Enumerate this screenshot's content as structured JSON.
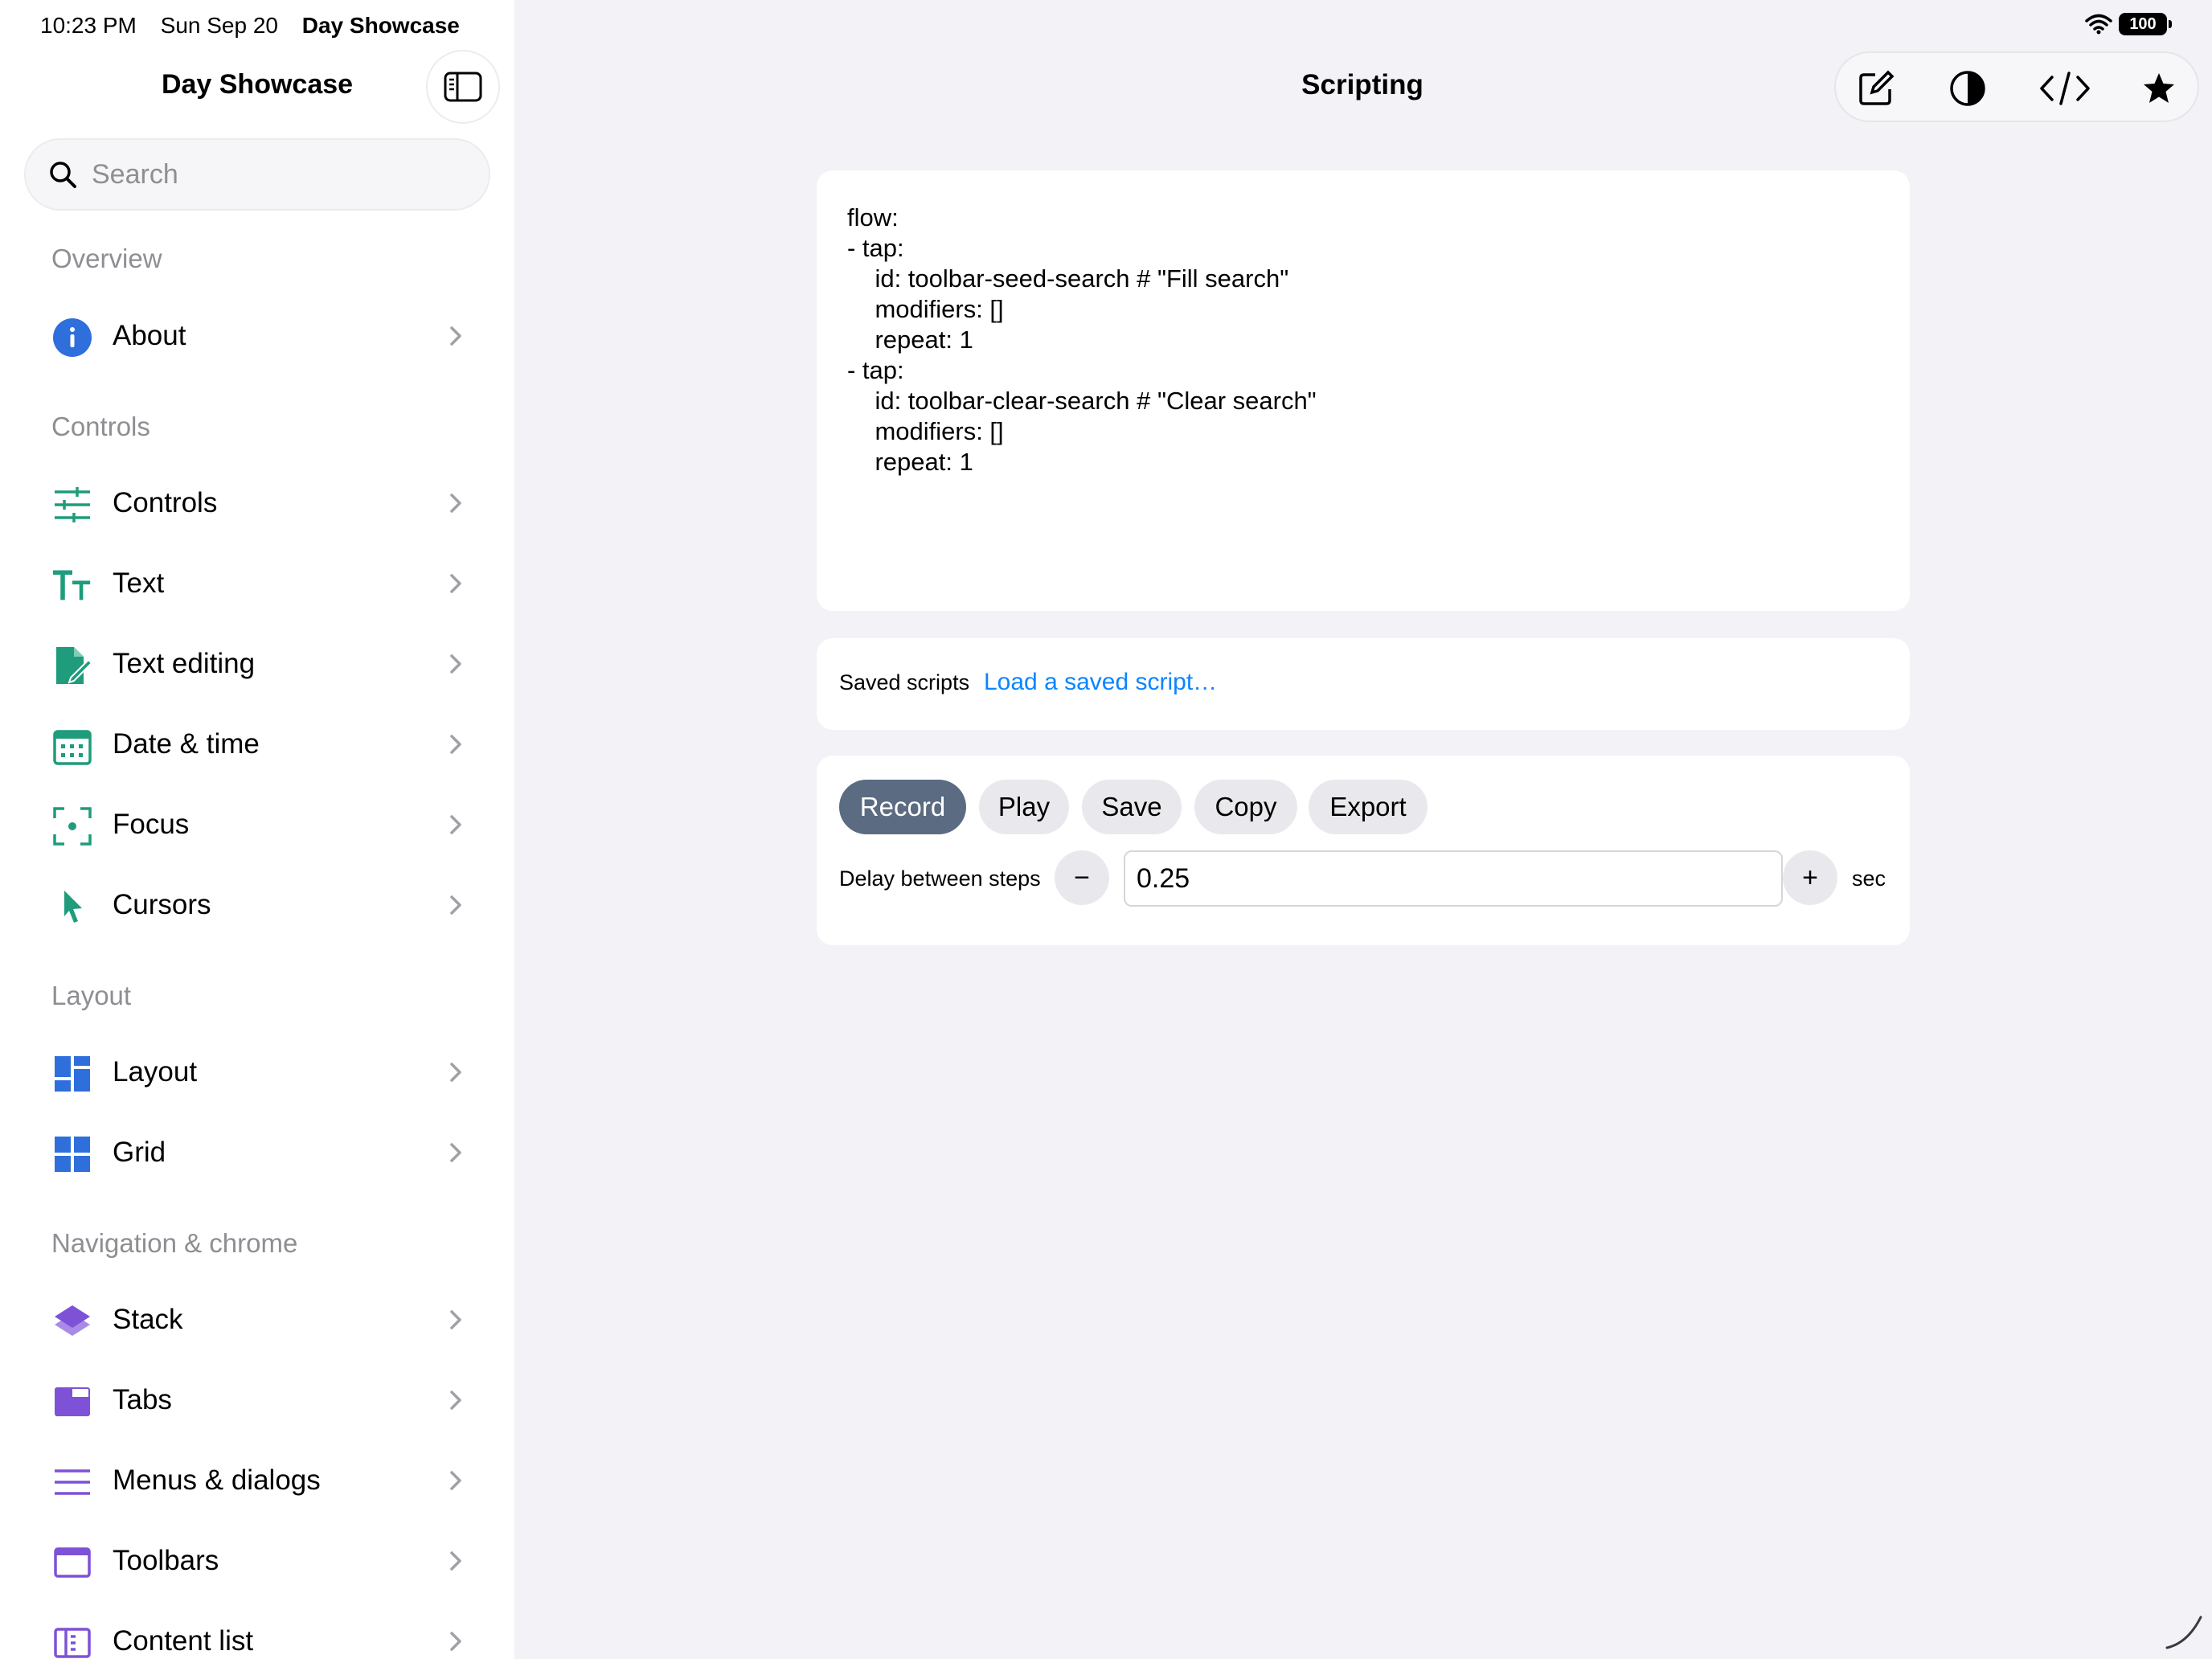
{
  "status_bar": {
    "time": "10:23 PM",
    "date": "Sun Sep 20",
    "app": "Day Showcase",
    "battery": "100"
  },
  "sidebar": {
    "title": "Day Showcase",
    "search_placeholder": "Search",
    "sections": [
      {
        "header": "Overview",
        "items": [
          {
            "label": "About",
            "icon": "info-circle-icon",
            "color": "#2f6fdc"
          }
        ]
      },
      {
        "header": "Controls",
        "items": [
          {
            "label": "Controls",
            "icon": "sliders-icon",
            "color": "#1e9c7c"
          },
          {
            "label": "Text",
            "icon": "text-size-icon",
            "color": "#1e9c7c"
          },
          {
            "label": "Text editing",
            "icon": "document-edit-icon",
            "color": "#1e9c7c"
          },
          {
            "label": "Date & time",
            "icon": "calendar-icon",
            "color": "#1e9c7c"
          },
          {
            "label": "Focus",
            "icon": "focus-viewfinder-icon",
            "color": "#1e9c7c"
          },
          {
            "label": "Cursors",
            "icon": "cursor-arrow-icon",
            "color": "#1e9c7c"
          }
        ]
      },
      {
        "header": "Layout",
        "items": [
          {
            "label": "Layout",
            "icon": "layout-grid-icon",
            "color": "#2f6fdc"
          },
          {
            "label": "Grid",
            "icon": "grid-icon",
            "color": "#2f6fdc"
          }
        ]
      },
      {
        "header": "Navigation & chrome",
        "items": [
          {
            "label": "Stack",
            "icon": "layers-stack-icon",
            "color": "#7d52d6"
          },
          {
            "label": "Tabs",
            "icon": "tabs-icon",
            "color": "#7d52d6"
          },
          {
            "label": "Menus & dialogs",
            "icon": "menu-lines-icon",
            "color": "#7d52d6"
          },
          {
            "label": "Toolbars",
            "icon": "toolbar-window-icon",
            "color": "#7d52d6"
          },
          {
            "label": "Content list",
            "icon": "content-list-icon",
            "color": "#7d52d6"
          }
        ]
      }
    ]
  },
  "main": {
    "title": "Scripting",
    "toolbar_icons": [
      "compose-icon",
      "contrast-icon",
      "code-icon",
      "star-icon"
    ],
    "script_text": "flow:\n- tap:\n    id: toolbar-seed-search # \"Fill search\"\n    modifiers: []\n    repeat: 1\n- tap:\n    id: toolbar-clear-search # \"Clear search\"\n    modifiers: []\n    repeat: 1",
    "saved_scripts": {
      "label": "Saved scripts",
      "link": "Load a saved script…"
    },
    "actions": {
      "record": "Record",
      "play": "Play",
      "save": "Save",
      "copy": "Copy",
      "export": "Export"
    },
    "delay": {
      "label": "Delay between steps",
      "minus": "−",
      "value": "0.25",
      "plus": "+",
      "unit": "sec"
    }
  }
}
